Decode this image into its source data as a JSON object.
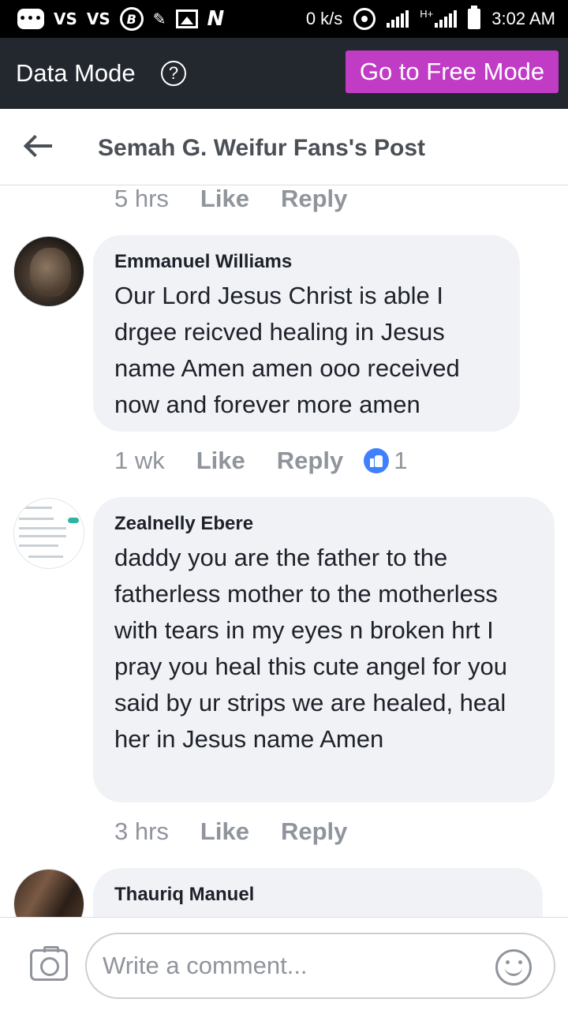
{
  "status_bar": {
    "network_speed": "0 k/s",
    "network_type": "H+",
    "time": "3:02 AM",
    "icons": [
      "message-icon",
      "vs-icon",
      "vs-icon",
      "b-icon",
      "edit-icon",
      "image-icon",
      "n-icon",
      "hotspot-icon",
      "signal-icon",
      "signal-icon",
      "battery-icon"
    ],
    "vs_label": "VS",
    "b_label": "B",
    "n_label": "N"
  },
  "data_mode": {
    "title": "Data Mode",
    "help": "?",
    "free_mode_button": "Go to Free Mode",
    "accent_color": "#c13cc5"
  },
  "header": {
    "title": "Semah G. Weifur Fans's Post"
  },
  "comments": [
    {
      "author": "",
      "text": "",
      "time": "5 hrs",
      "like": "Like",
      "reply": "Reply",
      "reactions": null
    },
    {
      "author": "Emmanuel Williams",
      "text": "Our Lord Jesus Christ is able I drgee reicved healing in Jesus name Amen amen ooo received now and forever more amen",
      "time": "1 wk",
      "like": "Like",
      "reply": "Reply",
      "reactions": "1"
    },
    {
      "author": "Zealnelly Ebere",
      "text": "daddy you are the father to the fatherless mother to the motherless with tears in my eyes n broken hrt I pray you heal this cute angel for you said by ur strips we are healed, heal her in Jesus name Amen",
      "time": "3 hrs",
      "like": "Like",
      "reply": "Reply",
      "reactions": null
    },
    {
      "author": "Thauriq Manuel",
      "text": ""
    }
  ],
  "composer": {
    "placeholder": "Write a comment...",
    "value": ""
  },
  "colors": {
    "like_badge": "#4080ff",
    "bubble": "#f1f2f6",
    "meta_text": "#90949c"
  }
}
